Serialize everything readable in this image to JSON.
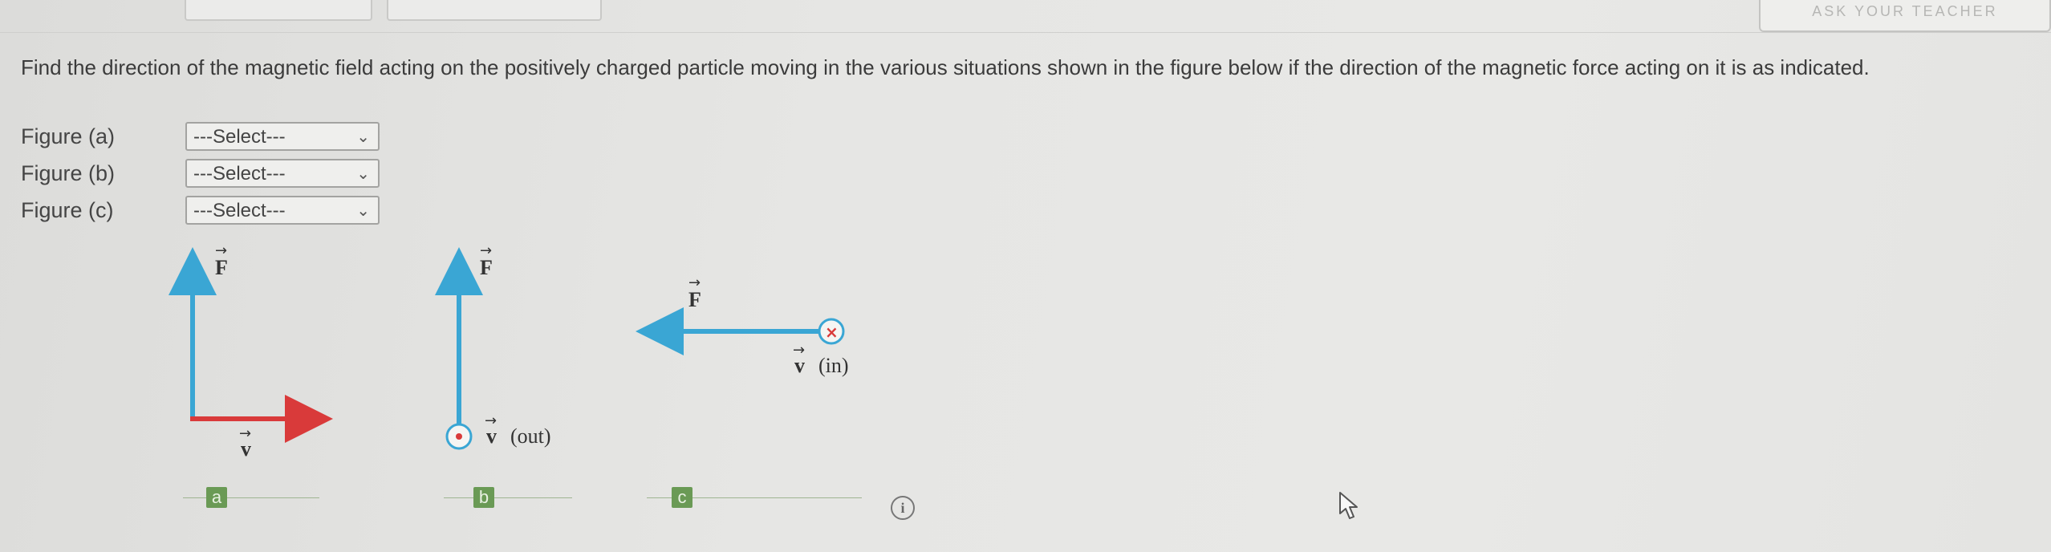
{
  "header": {
    "right_button_label": "ASK YOUR TEACHER"
  },
  "question": {
    "text": "Find the direction of the magnetic field acting on the positively charged particle moving in the various situations shown in the figure below if the direction of the magnetic force acting on it is as indicated."
  },
  "answers": [
    {
      "label": "Figure (a)",
      "selected": "---Select---"
    },
    {
      "label": "Figure (b)",
      "selected": "---Select---"
    },
    {
      "label": "Figure (c)",
      "selected": "---Select---"
    }
  ],
  "figures": {
    "a": {
      "force_label": "F",
      "velocity_label": "v",
      "tag": "a"
    },
    "b": {
      "force_label": "F",
      "velocity_label": "v",
      "velocity_note": "(out)",
      "tag": "b"
    },
    "c": {
      "force_label": "F",
      "velocity_label": "v",
      "velocity_note": "(in)",
      "tag": "c"
    }
  },
  "colors": {
    "force_arrow": "#3aa6d4",
    "velocity_arrow": "#d93a3a",
    "tag_bg": "#6a9a55"
  },
  "icons": {
    "info": "i",
    "chevron": "⌄"
  }
}
